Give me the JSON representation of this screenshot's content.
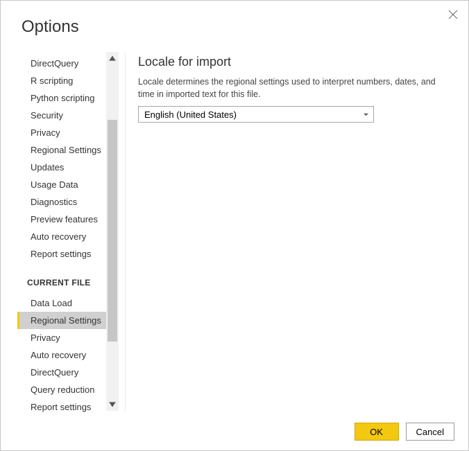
{
  "window": {
    "title": "Options"
  },
  "sidebar": {
    "global_items": [
      "DirectQuery",
      "R scripting",
      "Python scripting",
      "Security",
      "Privacy",
      "Regional Settings",
      "Updates",
      "Usage Data",
      "Diagnostics",
      "Preview features",
      "Auto recovery",
      "Report settings"
    ],
    "section_header": "CURRENT FILE",
    "file_items": [
      "Data Load",
      "Regional Settings",
      "Privacy",
      "Auto recovery",
      "DirectQuery",
      "Query reduction",
      "Report settings"
    ],
    "selected_file_index": 1
  },
  "main": {
    "heading": "Locale for import",
    "description": "Locale determines the regional settings used to interpret numbers, dates, and time in imported text for this file.",
    "dropdown_value": "English (United States)"
  },
  "footer": {
    "ok": "OK",
    "cancel": "Cancel"
  }
}
